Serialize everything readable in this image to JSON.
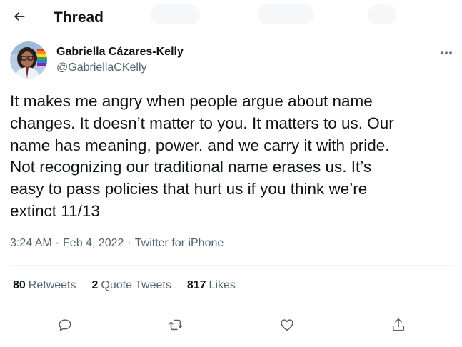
{
  "header": {
    "title": "Thread",
    "back_icon": "arrow-left-icon"
  },
  "author": {
    "name": "Gabriella Cázares-Kelly",
    "handle": "@GabriellaCKelly",
    "avatar_icon": "avatar-photo",
    "more_icon": "more-horizontal-icon"
  },
  "tweet": {
    "text": "It makes me angry when people argue about name\nchanges. It doesn’t matter to you. It matters to us. Our\nname has meaning, power. and we carry it with pride.\nNot recognizing our traditional name erases us. It’s\neasy to pass policies that hurt us if you think we’re\nextinct 11/13"
  },
  "meta": {
    "time": "3:24 AM",
    "separator": "·",
    "date": "Feb 4, 2022",
    "source": "Twitter for iPhone"
  },
  "stats": {
    "retweets_count": "80",
    "retweets_label": "Retweets",
    "quotes_count": "2",
    "quotes_label": "Quote Tweets",
    "likes_count": "817",
    "likes_label": "Likes"
  },
  "actions": {
    "reply_icon": "reply-icon",
    "retweet_icon": "retweet-icon",
    "like_icon": "heart-icon",
    "share_icon": "share-icon"
  },
  "colors": {
    "text_primary": "#0f1419",
    "text_secondary": "#536471",
    "divider": "#eff3f4"
  }
}
